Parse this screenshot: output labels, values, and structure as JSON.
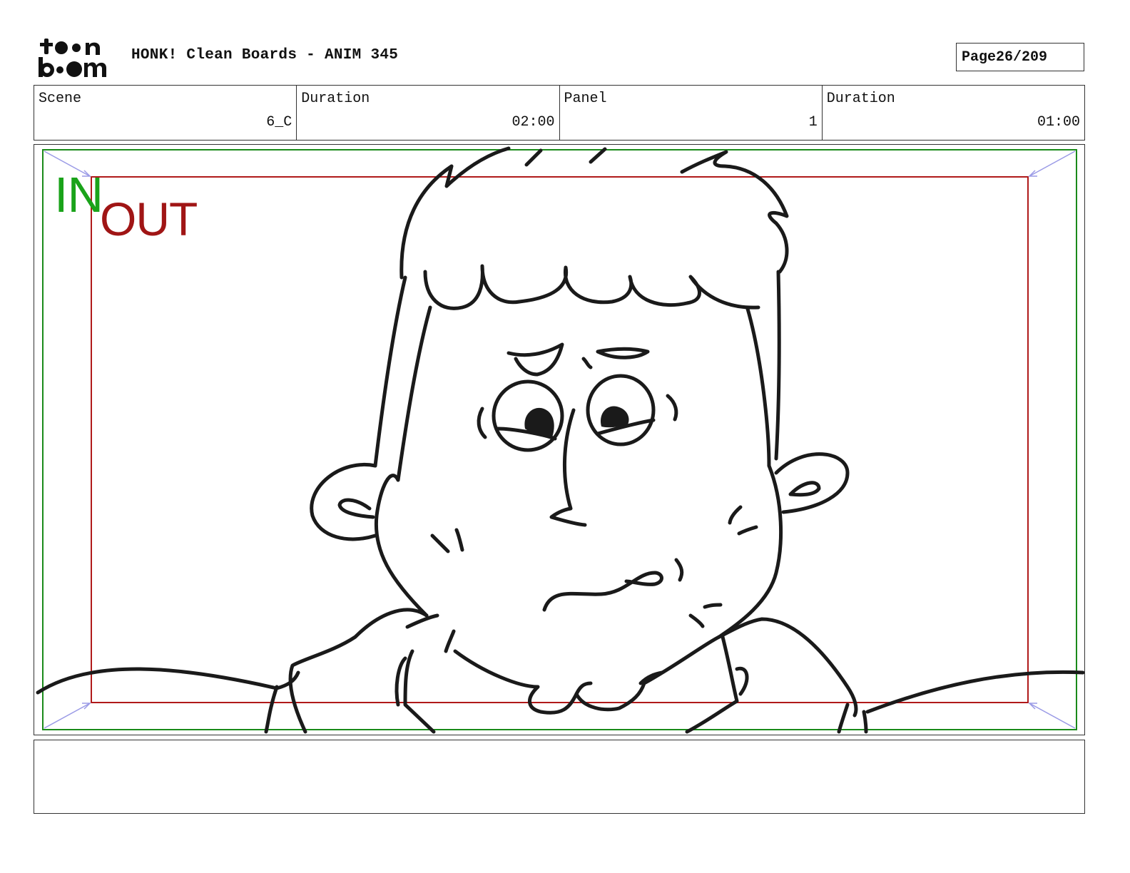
{
  "header": {
    "logo_text": "toon boom",
    "title": "HONK! Clean Boards - ANIM 345",
    "page_label": "Page",
    "page_value": "26/209"
  },
  "info": [
    {
      "label": "Scene",
      "value": "6_C"
    },
    {
      "label": "Duration",
      "value": "02:00"
    },
    {
      "label": "Panel",
      "value": "1"
    },
    {
      "label": "Duration",
      "value": "01:00"
    }
  ],
  "panel": {
    "in_label": "IN",
    "out_label": "OUT",
    "colors": {
      "in_frame": "#1a8a1a",
      "out_frame": "#b01a1a",
      "in_text": "#1aa31a",
      "out_text": "#a01515",
      "camera_arrows": "#9a9ae6",
      "ink": "#1a1a1a"
    }
  },
  "notes": {
    "text": ""
  }
}
